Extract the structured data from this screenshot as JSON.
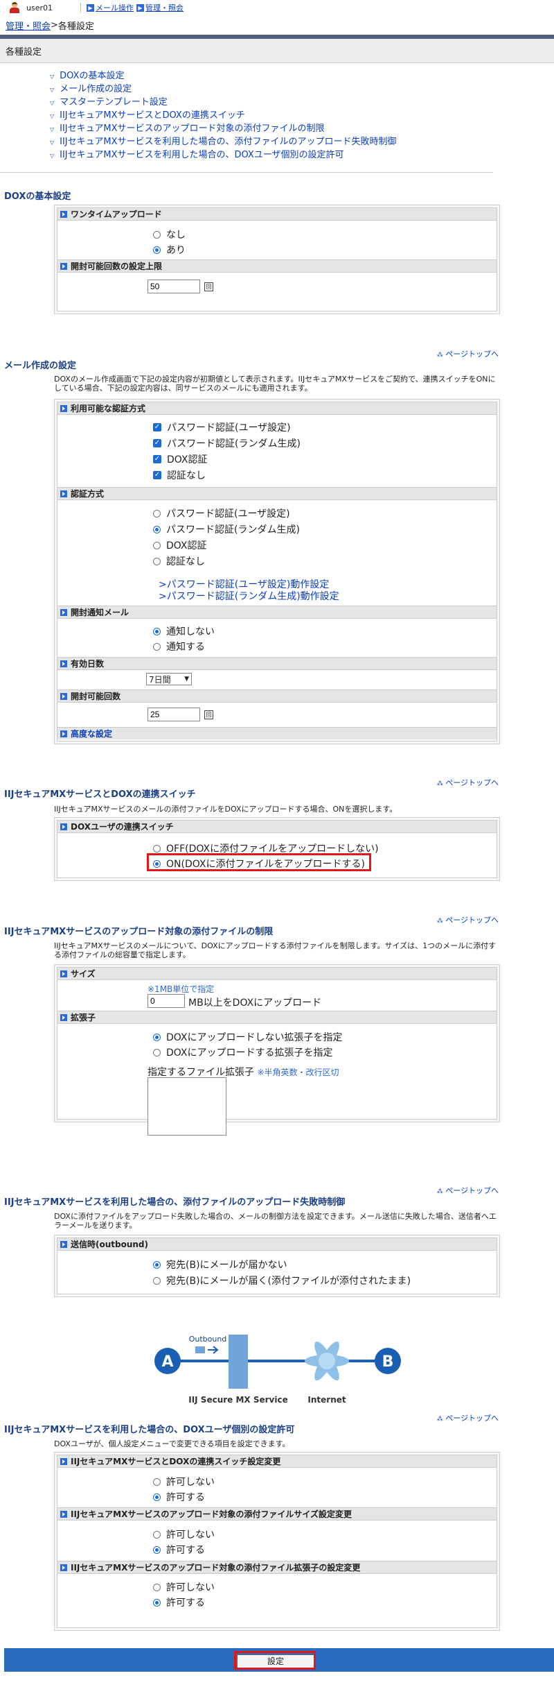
{
  "header": {
    "user": "user01",
    "nav": [
      "メール操作",
      "管理・照会"
    ]
  },
  "breadcrumb": {
    "parent": "管理・照会",
    "sep": " > ",
    "current": "各種設定"
  },
  "page_title": "各種設定",
  "toc": [
    "DOXの基本設定",
    "メール作成の設定",
    "マスターテンプレート設定",
    "IIJセキュアMXサービスとDOXの連携スイッチ",
    "IIJセキュアMXサービスのアップロード対象の添付ファイルの制限",
    "IIJセキュアMXサービスを利用した場合の、添付ファイルのアップロード失敗時制御",
    "IIJセキュアMXサービスを利用した場合の、DOXユーザ個別の設定許可"
  ],
  "pagetop": "ページトップへ",
  "s1": {
    "title": "DOXの基本設定",
    "onetime": "ワンタイムアップロード",
    "none": "なし",
    "yes": "あり",
    "open_limit": "開封可能回数の設定上限",
    "open_limit_value": "50",
    "unit": "回"
  },
  "s2": {
    "title": "メール作成の設定",
    "desc": "DOXのメール作成画面で下記の設定内容が初期値として表示されます。IIJセキュアMXサービスをご契約で、連携スイッチをONにしている場合、下記の設定内容は、同サービスのメールにも適用されます。",
    "auth_avail": "利用可能な認証方式",
    "a1": "パスワード認証(ユーザ設定)",
    "a2": "パスワード認証(ランダム生成)",
    "a3": "DOX認証",
    "a4": "認証なし",
    "auth": "認証方式",
    "b1": "パスワード認証(ユーザ設定)",
    "b2": "パスワード認証(ランダム生成)",
    "b3": "DOX認証",
    "b4": "認証なし",
    "l1": ">パスワード認証(ユーザ設定)動作設定",
    "l2": ">パスワード認証(ランダム生成)動作設定",
    "notify": "開封通知メール",
    "n1": "通知しない",
    "n2": "通知する",
    "days": "有効日数",
    "days_value": "7日間",
    "open_count": "開封可能回数",
    "open_count_value": "25",
    "unit": "回",
    "advanced": "高度な設定"
  },
  "s3": {
    "title": "IIJセキュアMXサービスとDOXの連携スイッチ",
    "desc": "IIJセキュアMXサービスのメールの添付ファイルをDOXにアップロードする場合、ONを選択します。",
    "sub": "DOXユーザの連携スイッチ",
    "off": "OFF(DOXに添付ファイルをアップロードしない)",
    "on": "ON(DOXに添付ファイルをアップロードする)"
  },
  "s4": {
    "title": "IIJセキュアMXサービスのアップロード対象の添付ファイルの制限",
    "desc": "IIJセキュアMXサービスのメールについて、DOXにアップロードする添付ファイルを制限します。サイズは、1つのメールに添付する添付ファイルの総容量で指定します。",
    "size": "サイズ",
    "note": "※1MB単位で指定",
    "size_value": "0",
    "size_text": "MB以上をDOXにアップロード",
    "ext": "拡張子",
    "e1": "DOXにアップロードしない拡張子を指定",
    "e2": "DOXにアップロードする拡張子を指定",
    "ext_label": "指定するファイル拡張子",
    "ext_note": "※半角英数・改行区切"
  },
  "s5": {
    "title": "IIJセキュアMXサービスを利用した場合の、添付ファイルのアップロード失敗時制御",
    "desc": "DOXに添付ファイルをアップロード失敗した場合の、メールの制御方法を設定できます。メール送信に失敗した場合、送信者へエラーメールを送ります。",
    "sub": "送信時(outbound)",
    "o1": "宛先(B)にメールが届かない",
    "o2": "宛先(B)にメールが届く(添付ファイルが添付されたまま)"
  },
  "diagram": {
    "outbound": "Outbound",
    "a": "A",
    "b": "B",
    "mx": "IIJ Secure MX Service",
    "internet": "Internet"
  },
  "s6": {
    "title": "IIJセキュアMXサービスを利用した場合の、DOXユーザ個別の設定許可",
    "desc": "DOXユーザが、個人設定メニューで変更できる項目を設定できます。",
    "sub1": "IIJセキュアMXサービスとDOXの連携スイッチ設定変更",
    "sub2": "IIJセキュアMXサービスのアップロード対象の添付ファイルサイズ設定変更",
    "sub3": "IIJセキュアMXサービスのアップロード対象の添付ファイル拡張子の設定変更",
    "deny": "許可しない",
    "allow": "許可する"
  },
  "submit": "設定"
}
